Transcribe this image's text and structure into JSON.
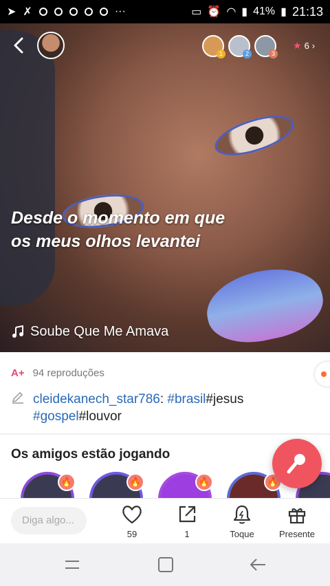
{
  "status_bar": {
    "battery": "41%",
    "time": "21:13"
  },
  "video": {
    "lyric_lines": [
      "Desde o momento em que",
      "os meus olhos levantei"
    ],
    "song_title": "Soube Que Me Amava",
    "viewer_count": "6",
    "rank_badges": [
      "1",
      "2",
      "3"
    ]
  },
  "info": {
    "plays_icon_text": "A+",
    "plays": "94 reproduções",
    "caption": {
      "user": "cleidekanech_star786",
      "sep": ": ",
      "tag1": "#brasil",
      "word1": "#jesus",
      "tag2": "#gospel",
      "word2": "#louvor"
    }
  },
  "friends": {
    "title": "Os amigos estão jogando"
  },
  "actions": {
    "comment_placeholder": "Diga algo...",
    "like_count": "59",
    "share_count": "1",
    "toque_label": "Toque",
    "gift_label": "Presente"
  },
  "colors": {
    "accent": "#e4476d",
    "tag": "#2a69b8",
    "mic_button": "#f0555f"
  }
}
